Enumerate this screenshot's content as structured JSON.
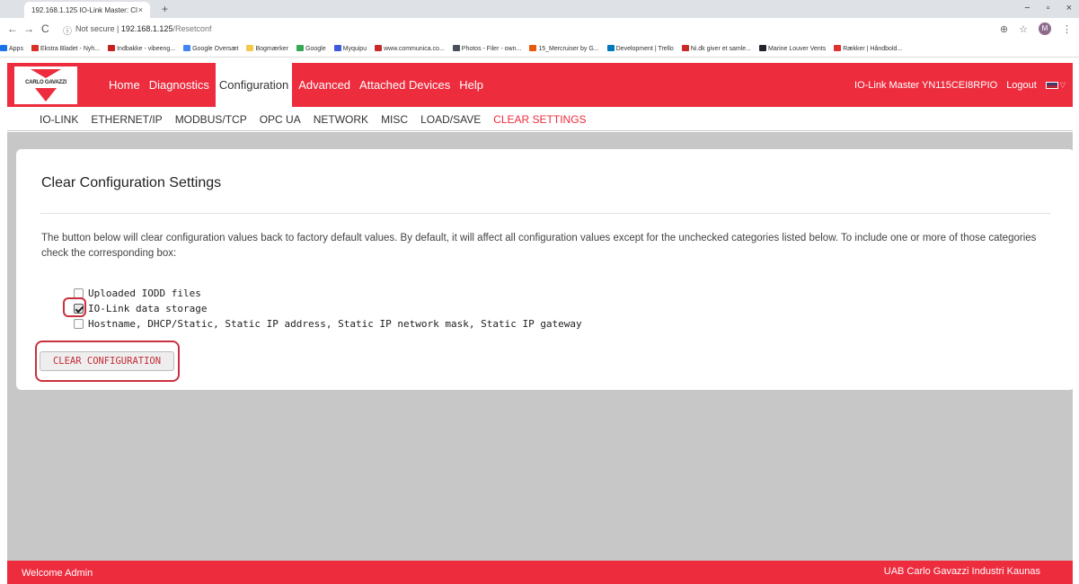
{
  "browser": {
    "tab_title": "192.168.1.125 IO-Link Master: Cl",
    "tab_close": "×",
    "new_tab": "+",
    "win_min": "−",
    "win_max": "▫",
    "win_close": "×",
    "back": "←",
    "forward": "→",
    "reload": "C",
    "security": "Not secure",
    "host": "192.168.1.125",
    "path": "/Resetconf",
    "zoom_icon": "⊕",
    "star_icon": "☆",
    "avatar": "M",
    "menu_icon": "⋮",
    "bookmarks": [
      {
        "label": "Apps",
        "color": "#1a73e8"
      },
      {
        "label": "Ekstra Bladet - Nyh...",
        "color": "#d93025"
      },
      {
        "label": "Indbakke - vibeeng...",
        "color": "#c5221f"
      },
      {
        "label": "Google Oversæt",
        "color": "#4285f4"
      },
      {
        "label": "Bogmærker",
        "color": "#f2c94c"
      },
      {
        "label": "Google",
        "color": "#34a853"
      },
      {
        "label": "Myquipu",
        "color": "#3b5bdb"
      },
      {
        "label": "www.communica.co...",
        "color": "#c92a2a"
      },
      {
        "label": "Photos - Filer - own...",
        "color": "#495057"
      },
      {
        "label": "15_Mercruiser by G...",
        "color": "#e8590c"
      },
      {
        "label": "Development | Trello",
        "color": "#0079bf"
      },
      {
        "label": "Ni.dk giver et samle...",
        "color": "#c92a2a"
      },
      {
        "label": "Marine Louver Vents",
        "color": "#212529"
      },
      {
        "label": "Rækker | Håndbold...",
        "color": "#e03131"
      }
    ]
  },
  "header": {
    "logo_text": "CARLO GAVAZZI",
    "nav": [
      {
        "label": "Home",
        "active": false
      },
      {
        "label": "Diagnostics",
        "active": false
      },
      {
        "label": "Configuration",
        "active": true
      },
      {
        "label": "Advanced",
        "active": false
      },
      {
        "label": "Attached Devices",
        "active": false
      },
      {
        "label": "Help",
        "active": false
      }
    ],
    "device_name": "IO-Link Master YN115CEI8RPIO",
    "logout": "Logout",
    "caret": "▽"
  },
  "sub_nav": [
    {
      "label": "IO-LINK",
      "active": false
    },
    {
      "label": "ETHERNET/IP",
      "active": false
    },
    {
      "label": "MODBUS/TCP",
      "active": false
    },
    {
      "label": "OPC UA",
      "active": false
    },
    {
      "label": "NETWORK",
      "active": false
    },
    {
      "label": "MISC",
      "active": false
    },
    {
      "label": "LOAD/SAVE",
      "active": false
    },
    {
      "label": "CLEAR SETTINGS",
      "active": true
    }
  ],
  "card": {
    "title": "Clear Configuration Settings",
    "description": "The button below will clear configuration values back to factory default values. By default, it will affect all configuration values except for the unchecked categories listed below. To include one or more of those categories check the corresponding box:",
    "options": [
      {
        "label": "Uploaded IODD files",
        "checked": false
      },
      {
        "label": "IO-Link data storage",
        "checked": true
      },
      {
        "label": "Hostname, DHCP/Static, Static IP address, Static IP network mask, Static IP gateway",
        "checked": false
      }
    ],
    "button": "CLEAR CONFIGURATION",
    "highlight_color": "#c9303e"
  },
  "footer": {
    "left": "Welcome Admin",
    "right": "UAB Carlo Gavazzi Industri Kaunas"
  },
  "colors": {
    "brand_red": "#ed2c3e",
    "content_gray": "#c7c7c7"
  }
}
